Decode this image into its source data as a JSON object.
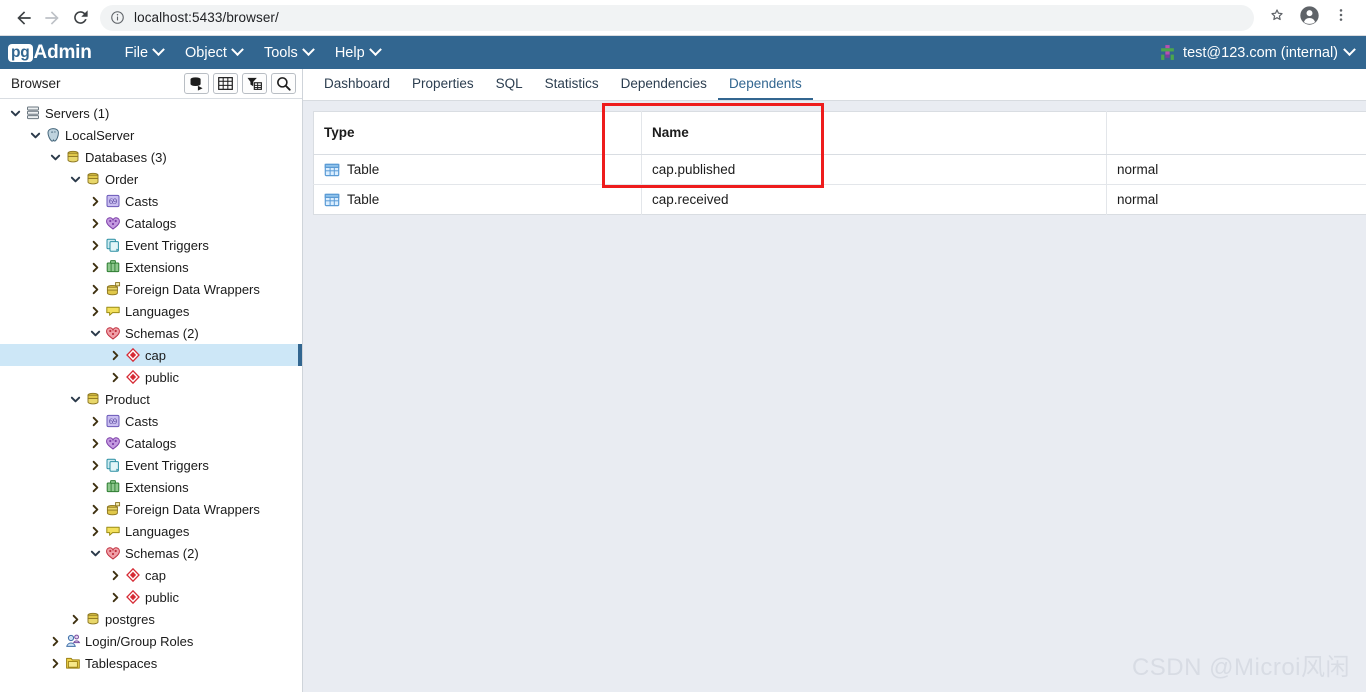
{
  "browser_chrome": {
    "back_icon": "back-arrow-icon",
    "forward_icon": "forward-arrow-icon",
    "reload_icon": "reload-icon",
    "info_icon": "site-info-icon",
    "url": "localhost:5433/browser/",
    "url_placeholder": "Search Google or type a URL",
    "bookmark_icon": "star-icon",
    "profile_icon": "profile-avatar-icon",
    "menu_icon": "three-dot-menu-icon"
  },
  "pgadmin": {
    "brand_badge": "pg",
    "brand_name": "Admin",
    "menus": [
      {
        "label": "File"
      },
      {
        "label": "Object"
      },
      {
        "label": "Tools"
      },
      {
        "label": "Help"
      }
    ],
    "user": {
      "label": "test@123.com (internal)",
      "avatar_icon": "user-avatar-icon"
    },
    "colors": {
      "topbar": "#326690",
      "accent": "#326690",
      "selection": "#cde7f7",
      "content_bg": "#e9ecf2",
      "annotation": "#ee1c1c"
    }
  },
  "browser_panel": {
    "title": "Browser",
    "toolbar": [
      {
        "name": "query-tool-button",
        "icon": "database-arrow-icon"
      },
      {
        "name": "view-data-button",
        "icon": "grid-table-icon"
      },
      {
        "name": "filtered-rows-button",
        "icon": "filter-table-icon"
      },
      {
        "name": "search-objects-button",
        "icon": "search-icon"
      }
    ],
    "tree": [
      {
        "label": "Servers (1)",
        "depth": 0,
        "state": "expanded",
        "icon": "servers-icon",
        "selected": false
      },
      {
        "label": "LocalServer",
        "depth": 1,
        "state": "expanded",
        "icon": "postgres-server-icon",
        "selected": false
      },
      {
        "label": "Databases (3)",
        "depth": 2,
        "state": "expanded",
        "icon": "databases-icon",
        "selected": false
      },
      {
        "label": "Order",
        "depth": 3,
        "state": "expanded",
        "icon": "database-icon",
        "selected": false
      },
      {
        "label": "Casts",
        "depth": 4,
        "state": "collapsed",
        "icon": "casts-icon",
        "selected": false
      },
      {
        "label": "Catalogs",
        "depth": 4,
        "state": "collapsed",
        "icon": "catalogs-icon",
        "selected": false
      },
      {
        "label": "Event Triggers",
        "depth": 4,
        "state": "collapsed",
        "icon": "event-triggers-icon",
        "selected": false
      },
      {
        "label": "Extensions",
        "depth": 4,
        "state": "collapsed",
        "icon": "extensions-icon",
        "selected": false
      },
      {
        "label": "Foreign Data Wrappers",
        "depth": 4,
        "state": "collapsed",
        "icon": "foreign-data-wrappers-icon",
        "selected": false
      },
      {
        "label": "Languages",
        "depth": 4,
        "state": "collapsed",
        "icon": "languages-icon",
        "selected": false
      },
      {
        "label": "Schemas (2)",
        "depth": 4,
        "state": "expanded",
        "icon": "schemas-icon",
        "selected": false
      },
      {
        "label": "cap",
        "depth": 5,
        "state": "collapsed",
        "icon": "schema-icon",
        "selected": true
      },
      {
        "label": "public",
        "depth": 5,
        "state": "collapsed",
        "icon": "schema-icon",
        "selected": false
      },
      {
        "label": "Product",
        "depth": 3,
        "state": "expanded",
        "icon": "database-icon",
        "selected": false
      },
      {
        "label": "Casts",
        "depth": 4,
        "state": "collapsed",
        "icon": "casts-icon",
        "selected": false
      },
      {
        "label": "Catalogs",
        "depth": 4,
        "state": "collapsed",
        "icon": "catalogs-icon",
        "selected": false
      },
      {
        "label": "Event Triggers",
        "depth": 4,
        "state": "collapsed",
        "icon": "event-triggers-icon",
        "selected": false
      },
      {
        "label": "Extensions",
        "depth": 4,
        "state": "collapsed",
        "icon": "extensions-icon",
        "selected": false
      },
      {
        "label": "Foreign Data Wrappers",
        "depth": 4,
        "state": "collapsed",
        "icon": "foreign-data-wrappers-icon",
        "selected": false
      },
      {
        "label": "Languages",
        "depth": 4,
        "state": "collapsed",
        "icon": "languages-icon",
        "selected": false
      },
      {
        "label": "Schemas (2)",
        "depth": 4,
        "state": "expanded",
        "icon": "schemas-icon",
        "selected": false
      },
      {
        "label": "cap",
        "depth": 5,
        "state": "collapsed",
        "icon": "schema-icon",
        "selected": false
      },
      {
        "label": "public",
        "depth": 5,
        "state": "collapsed",
        "icon": "schema-icon",
        "selected": false
      },
      {
        "label": "postgres",
        "depth": 3,
        "state": "collapsed",
        "icon": "database-icon",
        "selected": false
      },
      {
        "label": "Login/Group Roles",
        "depth": 2,
        "state": "collapsed",
        "icon": "login-roles-icon",
        "selected": false
      },
      {
        "label": "Tablespaces",
        "depth": 2,
        "state": "collapsed",
        "icon": "tablespaces-icon",
        "selected": false
      }
    ]
  },
  "main": {
    "tabs": [
      {
        "label": "Dashboard",
        "active": false
      },
      {
        "label": "Properties",
        "active": false
      },
      {
        "label": "SQL",
        "active": false
      },
      {
        "label": "Statistics",
        "active": false
      },
      {
        "label": "Dependencies",
        "active": false
      },
      {
        "label": "Dependents",
        "active": true
      }
    ],
    "grid": {
      "columns": [
        "Type",
        "Name",
        ""
      ],
      "rows": [
        {
          "type": "Table",
          "type_icon": "table-icon",
          "name": "cap.published",
          "restriction": "normal"
        },
        {
          "type": "Table",
          "type_icon": "table-icon",
          "name": "cap.received",
          "restriction": "normal"
        }
      ]
    },
    "annotation": {
      "shape": "rectangle",
      "color": "#ee1c1c"
    },
    "watermark": "CSDN @Microi风闲"
  }
}
